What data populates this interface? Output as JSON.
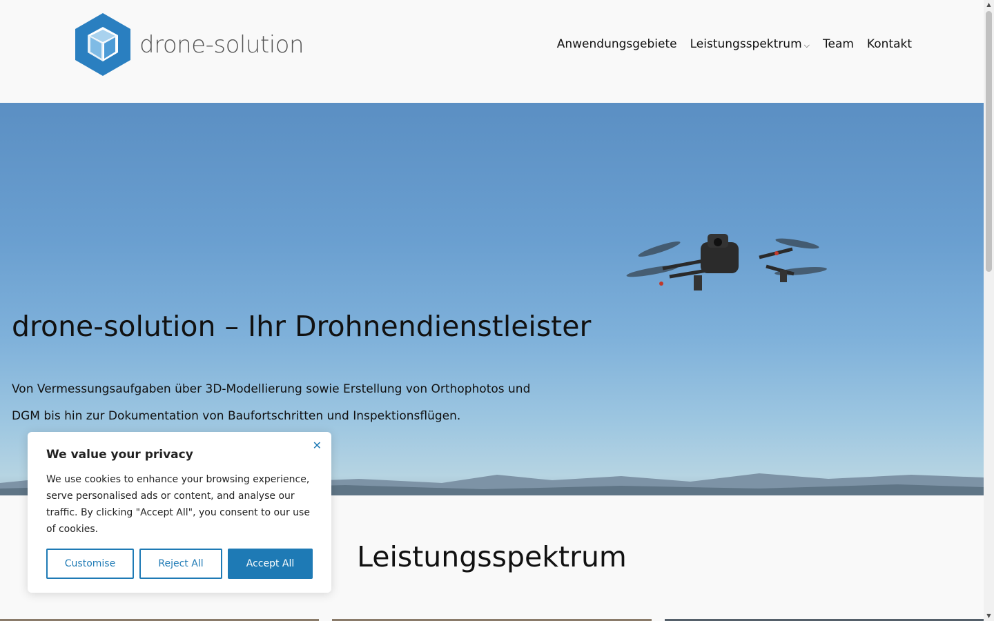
{
  "header": {
    "logo_text": "drone-solution",
    "nav": [
      {
        "label": "Anwendungsgebiete"
      },
      {
        "label": "Leistungsspektrum",
        "has_dropdown": true
      },
      {
        "label": "Team"
      },
      {
        "label": "Kontakt"
      }
    ]
  },
  "hero": {
    "title": "drone-solution – Ihr Drohnendienstleister",
    "text_line1": "Von Vermessungsaufgaben über 3D-Modellierung sowie Erstellung von Orthophotos und",
    "text_line2": "DGM bis hin zur Dokumentation von Baufortschritten und Inspektionsflügen."
  },
  "section": {
    "title": "Leistungsspektrum"
  },
  "cookie": {
    "title": "We value your privacy",
    "text": "We use cookies to enhance your browsing experience, serve personalised ads or content, and analyse our traffic. By clicking \"Accept All\", you consent to our use of cookies.",
    "close_icon": "close-icon",
    "customise_label": "Customise",
    "reject_label": "Reject All",
    "accept_label": "Accept All"
  },
  "icons": {
    "logo": "cube-logo-icon",
    "dropdown": "chevron-down-icon"
  },
  "colors": {
    "brand_blue": "#1e7ab5",
    "logo_blue": "#2a7fc0",
    "background": "#f9f9f9"
  }
}
